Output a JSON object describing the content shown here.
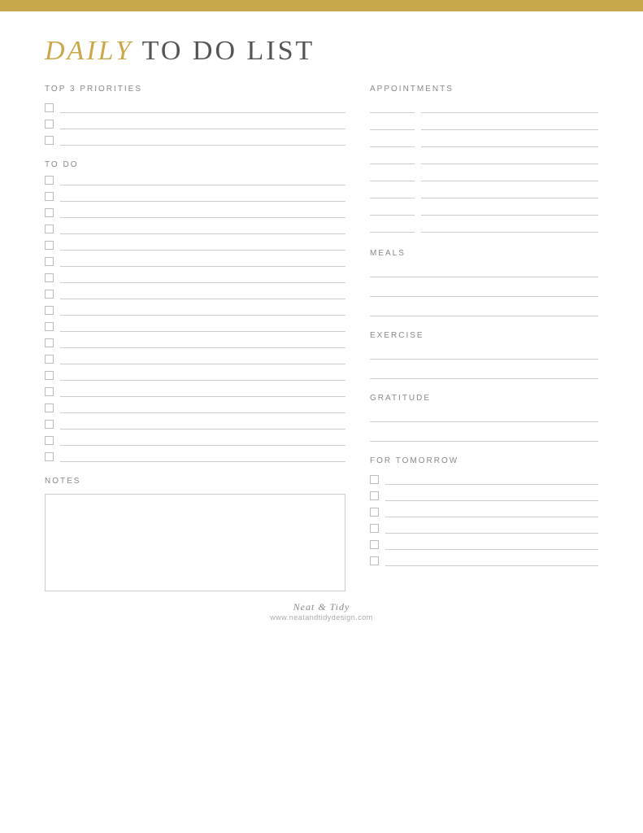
{
  "header": {
    "title_italic": "DAILY",
    "title_rest": " TO DO LIST",
    "gold_bar": true
  },
  "top3": {
    "label": "TOP 3 PRIORITIES",
    "items": [
      "",
      "",
      ""
    ]
  },
  "todo": {
    "label": "TO DO",
    "items": [
      "",
      "",
      "",
      "",
      "",
      "",
      "",
      "",
      "",
      "",
      "",
      "",
      "",
      "",
      "",
      "",
      "",
      ""
    ]
  },
  "notes": {
    "label": "NOTES"
  },
  "appointments": {
    "label": "APPOINTMENTS",
    "items": [
      "",
      "",
      "",
      "",
      "",
      "",
      "",
      ""
    ]
  },
  "meals": {
    "label": "MEALS",
    "items": [
      "",
      "",
      ""
    ]
  },
  "exercise": {
    "label": "EXERCISE",
    "items": [
      "",
      ""
    ]
  },
  "gratitude": {
    "label": "GRATITUDE",
    "items": [
      "",
      ""
    ]
  },
  "for_tomorrow": {
    "label": "FOR TOMORROW",
    "items": [
      "",
      "",
      "",
      "",
      "",
      ""
    ]
  },
  "footer": {
    "brand": "Neat & Tidy",
    "url": "www.neatandtidydesign.com"
  }
}
